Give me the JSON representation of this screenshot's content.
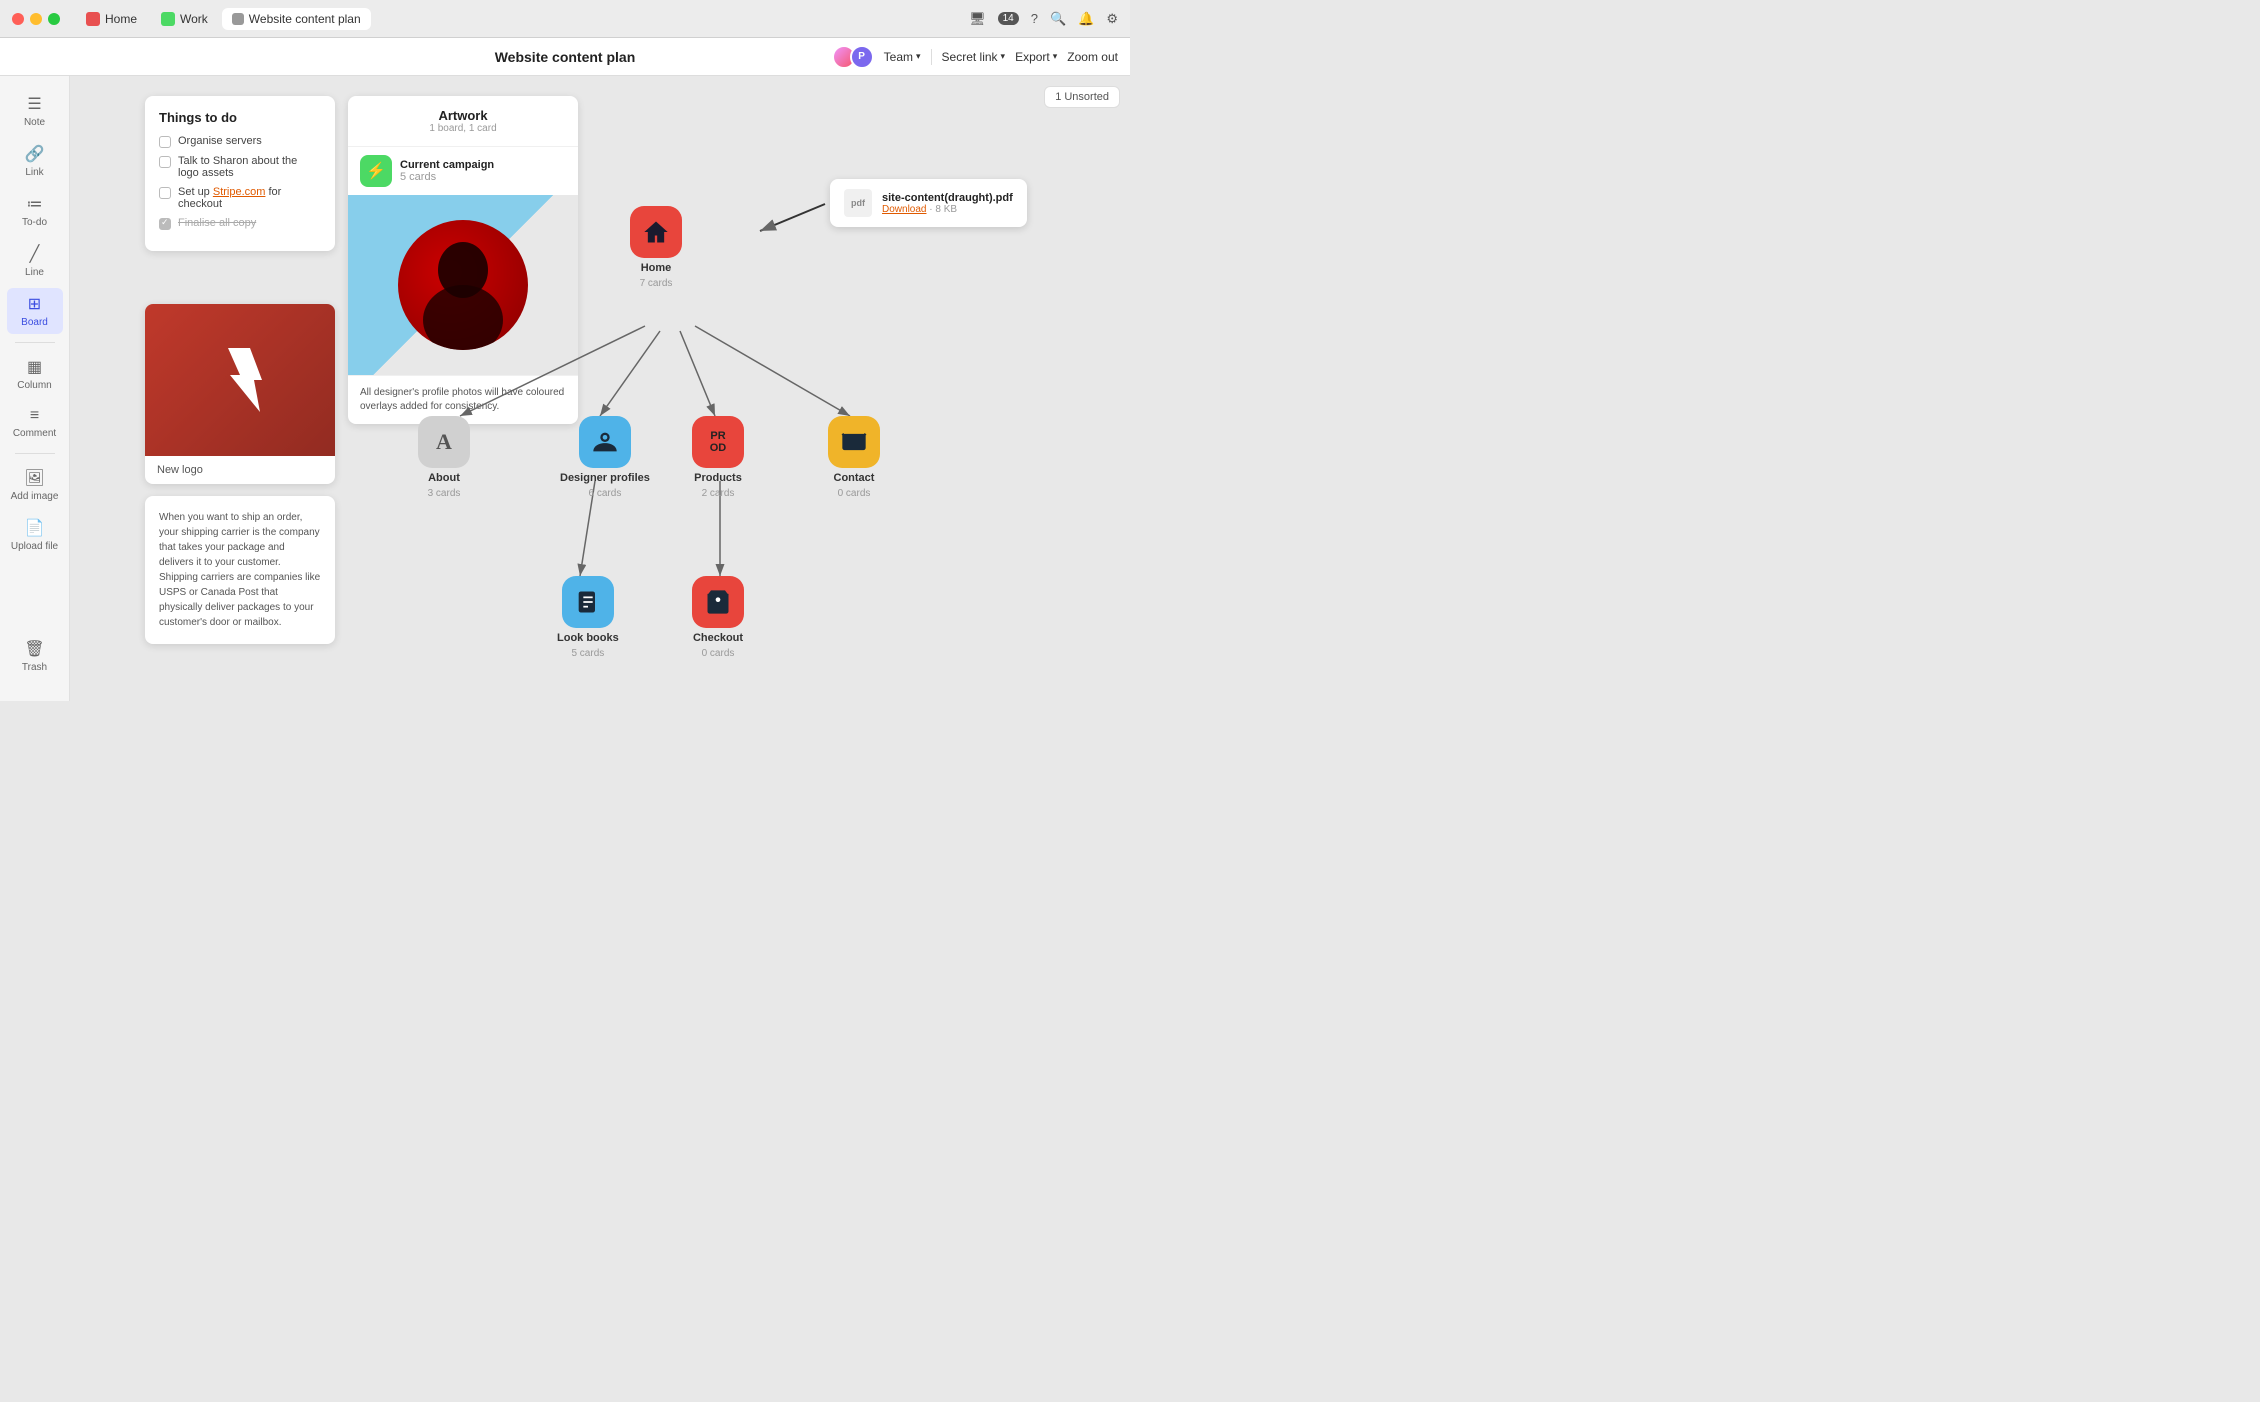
{
  "titlebar": {
    "tabs": [
      {
        "label": "Home",
        "type": "home",
        "active": false
      },
      {
        "label": "Work",
        "type": "work",
        "active": false
      },
      {
        "label": "Website content plan",
        "type": "doc",
        "active": true
      }
    ]
  },
  "toolbar": {
    "title": "Website content plan",
    "team_label": "Team",
    "secret_link_label": "Secret link",
    "export_label": "Export",
    "zoom_label": "Zoom out"
  },
  "sidebar": {
    "items": [
      {
        "label": "Note",
        "icon": "≡"
      },
      {
        "label": "Link",
        "icon": "🔗"
      },
      {
        "label": "To-do",
        "icon": "☰"
      },
      {
        "label": "Line",
        "icon": "/"
      },
      {
        "label": "Board",
        "icon": "⊞"
      },
      {
        "label": "Column",
        "icon": "▦"
      },
      {
        "label": "Comment",
        "icon": "☰"
      },
      {
        "label": "Add image",
        "icon": "⊞"
      },
      {
        "label": "Upload file",
        "icon": "📄"
      }
    ],
    "trash_label": "Trash"
  },
  "unsorted": {
    "label": "1 Unsorted"
  },
  "todo_card": {
    "title": "Things to do",
    "items": [
      {
        "text": "Organise servers",
        "checked": false,
        "strikethrough": false
      },
      {
        "text": "Talk to Sharon about the logo assets",
        "checked": false,
        "strikethrough": false
      },
      {
        "text": "Set up Stripe.com for checkout",
        "checked": false,
        "strikethrough": false,
        "has_link": true,
        "link_text": "Stripe.com"
      },
      {
        "text": "Finalise all copy",
        "checked": true,
        "strikethrough": true
      }
    ]
  },
  "artwork_card": {
    "title": "Artwork",
    "subtitle": "1 board, 1 card",
    "campaign_name": "Current campaign",
    "campaign_count": "5 cards",
    "caption": "All designer's profile photos will have coloured overlays added for consistency."
  },
  "logo_card": {
    "label": "New logo"
  },
  "text_note": {
    "text": "When you want to ship an order, your shipping carrier is the company that takes your package and delivers it to your customer. Shipping carriers are companies like USPS or Canada Post that physically deliver packages to your customer's door or mailbox."
  },
  "mind_map": {
    "home": {
      "label": "Home",
      "count": "7 cards"
    },
    "about": {
      "label": "About",
      "count": "3 cards"
    },
    "designer_profiles": {
      "label": "Designer profiles",
      "count": "6 cards"
    },
    "products": {
      "label": "Products",
      "count": "2 cards"
    },
    "contact": {
      "label": "Contact",
      "count": "0 cards"
    },
    "look_books": {
      "label": "Look books",
      "count": "5 cards"
    },
    "checkout": {
      "label": "Checkout",
      "count": "0 cards"
    }
  },
  "pdf": {
    "name": "site-content(draught).pdf",
    "download_label": "Download",
    "size": "8 KB",
    "type": "pdf"
  },
  "colors": {
    "red": "#e8453c",
    "blue": "#4fb3e8",
    "yellow": "#f0b429",
    "gray": "#d0d0d0",
    "prod_red": "#e8453c"
  }
}
